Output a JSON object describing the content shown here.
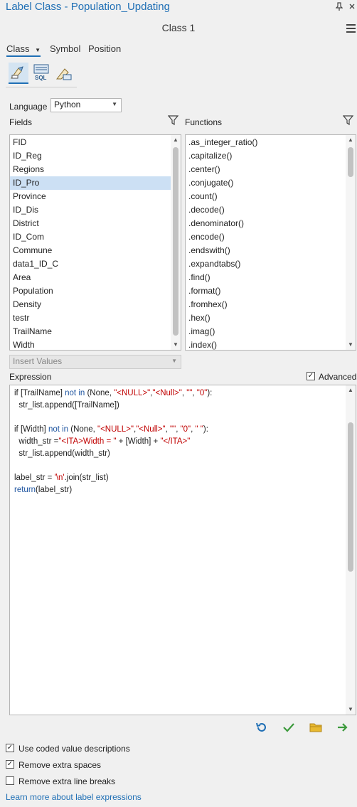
{
  "window": {
    "title": "Label Class - Population_Updating",
    "pin_icon": "pin-icon",
    "menu_icon": "chevron-icon",
    "close_icon": "close-icon"
  },
  "class_name": "Class 1",
  "tabs": [
    {
      "label": "Class",
      "active": true
    },
    {
      "label": "Symbol"
    },
    {
      "label": "Position"
    }
  ],
  "toolbar": [
    "expression-icon",
    "sql-query-icon",
    "label-placement-icon"
  ],
  "toolbar_sql_text": "SQL",
  "language": {
    "label": "Language",
    "value": "Python"
  },
  "fields": {
    "header": "Fields",
    "items": [
      "FID",
      "ID_Reg",
      "Regions",
      "ID_Pro",
      "Province",
      "ID_Dis",
      "District",
      "ID_Com",
      "Commune",
      "data1_ID_C",
      "Area",
      "Population",
      "Density",
      "testr",
      "TrailName",
      "Width"
    ],
    "selected": "ID_Pro"
  },
  "functions": {
    "header": "Functions",
    "items": [
      ".as_integer_ratio()",
      ".capitalize()",
      ".center()",
      ".conjugate()",
      ".count()",
      ".decode()",
      ".denominator()",
      ".encode()",
      ".endswith()",
      ".expandtabs()",
      ".find()",
      ".format()",
      ".fromhex()",
      ".hex()",
      ".imag()",
      ".index()"
    ]
  },
  "insert_values": {
    "label": "Insert Values"
  },
  "expression": {
    "label": "Expression",
    "advanced_label": "Advanced",
    "advanced_checked": true,
    "lines": [
      [
        {
          "t": "if [TrailName] "
        },
        {
          "t": "not in",
          "c": "kw"
        },
        {
          "t": " (None, "
        },
        {
          "t": "\"<NULL>\"",
          "c": "str"
        },
        {
          "t": ","
        },
        {
          "t": "\"<Null>\"",
          "c": "str"
        },
        {
          "t": ", "
        },
        {
          "t": "\"\"",
          "c": "str"
        },
        {
          "t": ", "
        },
        {
          "t": "\"0\"",
          "c": "str"
        },
        {
          "t": "):"
        }
      ],
      [
        {
          "t": "  str_list.append([TrailName])"
        }
      ],
      [
        {
          "t": ""
        }
      ],
      [
        {
          "t": "if [Width] "
        },
        {
          "t": "not in",
          "c": "kw"
        },
        {
          "t": " (None, "
        },
        {
          "t": "\"<NULL>\"",
          "c": "str"
        },
        {
          "t": ","
        },
        {
          "t": "\"<Null>\"",
          "c": "str"
        },
        {
          "t": ", "
        },
        {
          "t": "\"\"",
          "c": "str"
        },
        {
          "t": ", "
        },
        {
          "t": "\"0\"",
          "c": "str"
        },
        {
          "t": ", "
        },
        {
          "t": "\" \"",
          "c": "str"
        },
        {
          "t": "):"
        }
      ],
      [
        {
          "t": "  width_str ="
        },
        {
          "t": "\"<ITA>Width = \"",
          "c": "str"
        },
        {
          "t": " + [Width] + "
        },
        {
          "t": "\"</ITA>\"",
          "c": "str"
        }
      ],
      [
        {
          "t": "  str_list.append(width_str)"
        }
      ],
      [
        {
          "t": ""
        }
      ],
      [
        {
          "t": "label_str = "
        },
        {
          "t": "'\\n'",
          "c": "str"
        },
        {
          "t": ".join(str_list)"
        }
      ],
      [
        {
          "t": "return",
          "c": "kw"
        },
        {
          "t": "(label_str)"
        }
      ]
    ]
  },
  "actions": [
    "reset-icon",
    "verify-icon",
    "load-icon",
    "apply-icon"
  ],
  "options": [
    {
      "label": "Use coded value descriptions",
      "checked": true
    },
    {
      "label": "Remove extra spaces",
      "checked": true
    },
    {
      "label": "Remove extra line breaks",
      "checked": false
    }
  ],
  "learn_more": "Learn more about label expressions",
  "colors": {
    "accent": "#1f6fb5",
    "selection": "#cce0f4",
    "keyword": "#1f55a0",
    "string": "#c00000",
    "verify": "#3c9a3c",
    "folder": "#d9a520",
    "apply": "#3c9a3c"
  }
}
